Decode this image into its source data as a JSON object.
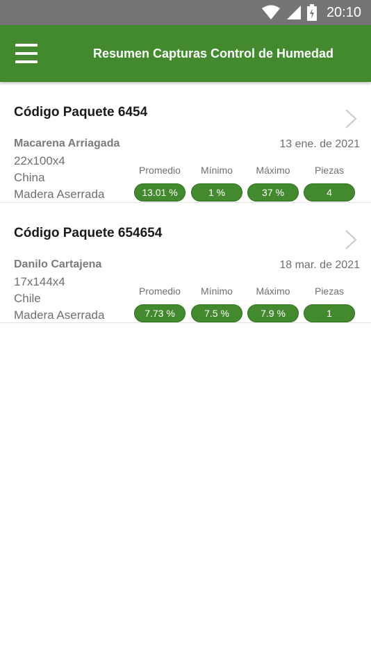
{
  "status_bar": {
    "time": "20:10"
  },
  "header": {
    "title": "Resumen Capturas Control de Humedad"
  },
  "stat_labels": {
    "avg": "Promedio",
    "min": "Mínimo",
    "max": "Máximo",
    "pieces": "Piezas"
  },
  "packages": [
    {
      "title": "Código Paquete 6454",
      "owner": "Macarena Arriagada",
      "date": "13 ene. de 2021",
      "dimensions": "22x100x4",
      "country": "China",
      "material": "Madera Aserrada",
      "avg": "13.01 %",
      "min": "1 %",
      "max": "37 %",
      "pieces": "4"
    },
    {
      "title": "Código Paquete 654654",
      "owner": "Danilo Cartajena",
      "date": "18 mar. de 2021",
      "dimensions": "17x144x4",
      "country": "Chile",
      "material": "Madera Aserrada",
      "avg": "7.73 %",
      "min": "7.5 %",
      "max": "7.9 %",
      "pieces": "1"
    }
  ],
  "colors": {
    "primary": "#438a2e",
    "status_bar": "#757575"
  }
}
